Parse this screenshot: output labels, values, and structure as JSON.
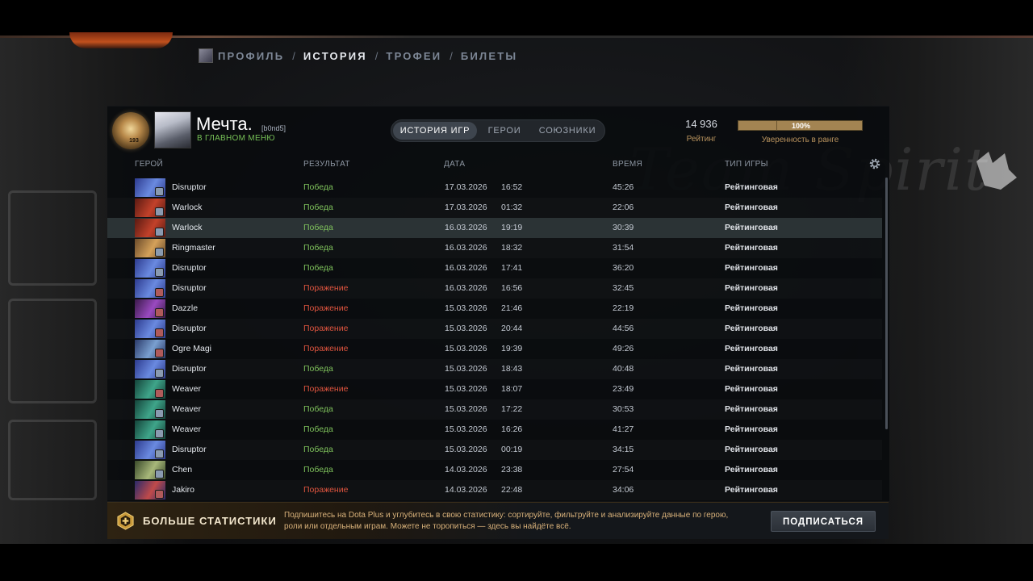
{
  "nav": {
    "items": [
      "ПРОФИЛЬ",
      "ИСТОРИЯ",
      "ТРОФЕИ",
      "БИЛЕТЫ"
    ],
    "separator": "/",
    "active_index": 1
  },
  "player": {
    "name": "Мечта.",
    "tag": "[b0nd5]",
    "status": "В ГЛАВНОМ МЕНЮ",
    "rank_number": "193"
  },
  "tabs": [
    "ИСТОРИЯ ИГР",
    "ГЕРОИ",
    "СОЮЗНИКИ"
  ],
  "stats": {
    "rating_value": "14 936",
    "rating_label": "Рейтинг",
    "confidence_value": "100%",
    "confidence_label": "Уверенность в ранге",
    "confidence_fraction": 1.0
  },
  "columns": {
    "hero": "ГЕРОЙ",
    "result": "РЕЗУЛЬТАТ",
    "date": "ДАТА",
    "duration": "ВРЕМЯ",
    "type": "ТИП ИГРЫ"
  },
  "matches": [
    {
      "hero": "Disruptor",
      "result": "Победа",
      "outcome": "win",
      "date": "17.03.2026",
      "time": "16:52",
      "duration": "45:26",
      "type": "Рейтинговая"
    },
    {
      "hero": "Warlock",
      "result": "Победа",
      "outcome": "win",
      "date": "17.03.2026",
      "time": "01:32",
      "duration": "22:06",
      "type": "Рейтинговая"
    },
    {
      "hero": "Warlock",
      "result": "Победа",
      "outcome": "win",
      "date": "16.03.2026",
      "time": "19:19",
      "duration": "30:39",
      "type": "Рейтинговая"
    },
    {
      "hero": "Ringmaster",
      "result": "Победа",
      "outcome": "win",
      "date": "16.03.2026",
      "time": "18:32",
      "duration": "31:54",
      "type": "Рейтинговая"
    },
    {
      "hero": "Disruptor",
      "result": "Победа",
      "outcome": "win",
      "date": "16.03.2026",
      "time": "17:41",
      "duration": "36:20",
      "type": "Рейтинговая"
    },
    {
      "hero": "Disruptor",
      "result": "Поражение",
      "outcome": "loss",
      "date": "16.03.2026",
      "time": "16:56",
      "duration": "32:45",
      "type": "Рейтинговая"
    },
    {
      "hero": "Dazzle",
      "result": "Поражение",
      "outcome": "loss",
      "date": "15.03.2026",
      "time": "21:46",
      "duration": "22:19",
      "type": "Рейтинговая"
    },
    {
      "hero": "Disruptor",
      "result": "Поражение",
      "outcome": "loss",
      "date": "15.03.2026",
      "time": "20:44",
      "duration": "44:56",
      "type": "Рейтинговая"
    },
    {
      "hero": "Ogre Magi",
      "result": "Поражение",
      "outcome": "loss",
      "date": "15.03.2026",
      "time": "19:39",
      "duration": "49:26",
      "type": "Рейтинговая"
    },
    {
      "hero": "Disruptor",
      "result": "Победа",
      "outcome": "win",
      "date": "15.03.2026",
      "time": "18:43",
      "duration": "40:48",
      "type": "Рейтинговая"
    },
    {
      "hero": "Weaver",
      "result": "Поражение",
      "outcome": "loss",
      "date": "15.03.2026",
      "time": "18:07",
      "duration": "23:49",
      "type": "Рейтинговая"
    },
    {
      "hero": "Weaver",
      "result": "Победа",
      "outcome": "win",
      "date": "15.03.2026",
      "time": "17:22",
      "duration": "30:53",
      "type": "Рейтинговая"
    },
    {
      "hero": "Weaver",
      "result": "Победа",
      "outcome": "win",
      "date": "15.03.2026",
      "time": "16:26",
      "duration": "41:27",
      "type": "Рейтинговая"
    },
    {
      "hero": "Disruptor",
      "result": "Победа",
      "outcome": "win",
      "date": "15.03.2026",
      "time": "00:19",
      "duration": "34:15",
      "type": "Рейтинговая"
    },
    {
      "hero": "Chen",
      "result": "Победа",
      "outcome": "win",
      "date": "14.03.2026",
      "time": "23:38",
      "duration": "27:54",
      "type": "Рейтинговая"
    },
    {
      "hero": "Jakiro",
      "result": "Поражение",
      "outcome": "loss",
      "date": "14.03.2026",
      "time": "22:48",
      "duration": "34:06",
      "type": "Рейтинговая"
    }
  ],
  "hero_colors": {
    "Disruptor": [
      "#2d3b8f",
      "#6a8ae0"
    ],
    "Warlock": [
      "#5a1a12",
      "#c2412a"
    ],
    "Ringmaster": [
      "#6a4a2a",
      "#d4a15a"
    ],
    "Dazzle": [
      "#3a1a4a",
      "#9a4ac0"
    ],
    "Ogre Magi": [
      "#2a3a6a",
      "#7aa0d0"
    ],
    "Weaver": [
      "#14443a",
      "#3fa58a"
    ],
    "Chen": [
      "#3a4a2a",
      "#a8b87a"
    ],
    "Jakiro": [
      "#2a2a6a",
      "#c04a4a"
    ]
  },
  "highlight_row": 2,
  "colors": {
    "win": "#7fc35c",
    "loss": "#e0553f",
    "accent_gold": "#b9935e"
  },
  "promo": {
    "title": "БОЛЬШЕ СТАТИСТИКИ",
    "text": "Подпишитесь на Dota Plus и углубитесь в свою статистику: сортируйте, фильтруйте и анализируйте данные по герою, роли или отдельным играм. Можете не торопиться — здесь вы найдёте всё.",
    "button": "ПОДПИСАТЬСЯ",
    "icon": "dota-plus-icon"
  },
  "background": {
    "logo_text": "Team Spirit"
  }
}
